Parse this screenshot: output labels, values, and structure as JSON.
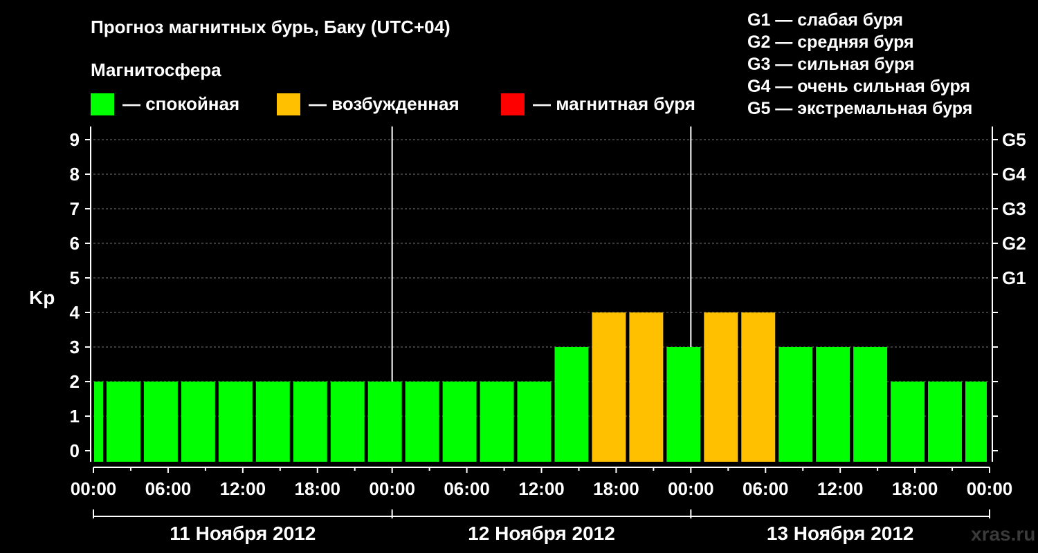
{
  "header": {
    "title": "Прогноз магнитных бурь, Баку (UTC+04)",
    "legend_title": "Магнитосфера",
    "legend": [
      {
        "label": "— спокойная",
        "color": "#00ff00"
      },
      {
        "label": "— возбужденная",
        "color": "#ffc000"
      },
      {
        "label": "— магнитная буря",
        "color": "#ff0000"
      }
    ],
    "g_scale": [
      "G1 — слабая буря",
      "G2 — средняя буря",
      "G3 — сильная буря",
      "G4 — очень сильная буря",
      "G5 — экстремальная буря"
    ]
  },
  "source": "xras.ru",
  "chart_data": {
    "type": "bar",
    "ylabel": "Kp",
    "ylim": [
      0,
      9
    ],
    "yticks": [
      0,
      1,
      2,
      3,
      4,
      5,
      6,
      7,
      8,
      9
    ],
    "right_axis_labels": [
      {
        "kp": 5,
        "label": "G1"
      },
      {
        "kp": 6,
        "label": "G2"
      },
      {
        "kp": 7,
        "label": "G3"
      },
      {
        "kp": 8,
        "label": "G4"
      },
      {
        "kp": 9,
        "label": "G5"
      }
    ],
    "x_ticks": [
      "00:00",
      "06:00",
      "12:00",
      "18:00",
      "00:00",
      "06:00",
      "12:00",
      "18:00",
      "00:00",
      "06:00",
      "12:00",
      "18:00",
      "00:00"
    ],
    "days": [
      "11 Ноября 2012",
      "12 Ноября 2012",
      "13 Ноября 2012"
    ],
    "interval_hours": 3,
    "first_bar_start_hour": -2,
    "values": [
      2,
      2,
      2,
      2,
      2,
      2,
      2,
      2,
      2,
      2,
      2,
      2,
      2,
      3,
      4,
      4,
      3,
      4,
      4,
      3,
      3,
      3,
      2,
      2,
      2
    ],
    "level_colors": {
      "calm": "#00ff00",
      "active": "#ffc000",
      "storm": "#ff0000"
    },
    "grid": "dashed horizontal at each Kp level, vertical at day boundaries"
  }
}
